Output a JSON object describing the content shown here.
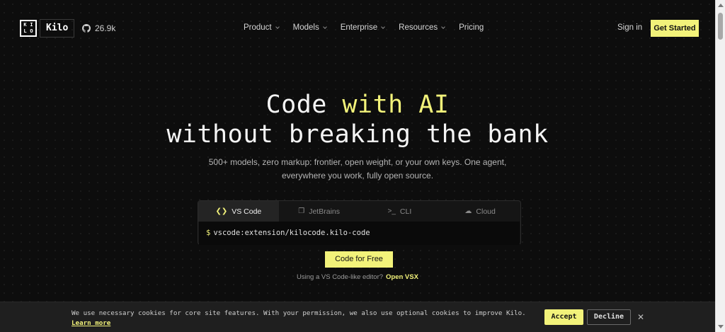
{
  "header": {
    "logo_mark": [
      "K",
      "I",
      "L",
      "O"
    ],
    "logo_word": "Kilo",
    "github_stars": "26.9k",
    "nav": [
      {
        "label": "Product",
        "dropdown": true
      },
      {
        "label": "Models",
        "dropdown": true
      },
      {
        "label": "Enterprise",
        "dropdown": true
      },
      {
        "label": "Resources",
        "dropdown": true
      },
      {
        "label": "Pricing",
        "dropdown": false
      }
    ],
    "sign_in": "Sign in",
    "get_started": "Get Started"
  },
  "hero": {
    "line1_plain": "Code ",
    "line1_accent": "with AI",
    "line2": "without breaking the bank",
    "subtitle": "500+ models, zero markup: frontier, open weight, or your own keys. One agent, everywhere you work, fully open source."
  },
  "install": {
    "tabs": [
      {
        "label": "VS Code",
        "icon": "vscode-icon",
        "active": true
      },
      {
        "label": "JetBrains",
        "icon": "jetbrains-icon",
        "active": false
      },
      {
        "label": "CLI",
        "icon": "terminal-icon",
        "active": false
      },
      {
        "label": "Cloud",
        "icon": "cloud-icon",
        "active": false
      }
    ],
    "prompt": "$",
    "command": "vscode:extension/kilocode.kilo-code"
  },
  "cta": {
    "code_free": "Code for Free",
    "vsx_text": "Using a VS Code-like editor?",
    "vsx_link": "Open VSX"
  },
  "cookie": {
    "text": "We use necessary cookies for core site features. With your permission, we also use optional cookies to improve Kilo.",
    "learn_more": "Learn more",
    "accept": "Accept",
    "decline": "Decline",
    "close": "✕"
  },
  "colors": {
    "accent": "#f2f27a",
    "background": "#0d0d0d"
  }
}
